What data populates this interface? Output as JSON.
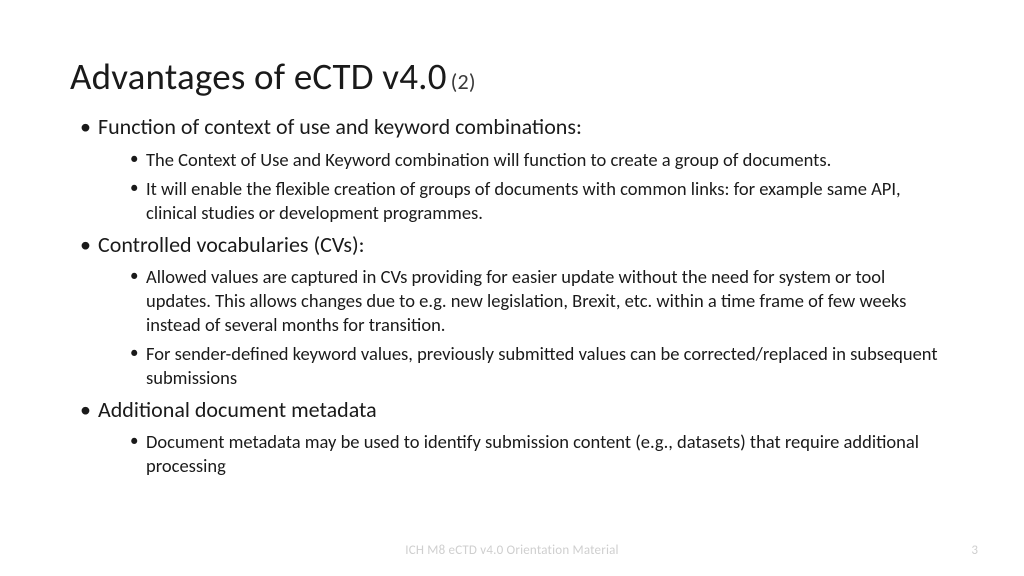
{
  "title": {
    "main": "Advantages of eCTD v4.0",
    "suffix": "(2)"
  },
  "bullets": [
    {
      "text": "Function of context of use and keyword combinations:",
      "children": [
        "The Context of Use and Keyword combination will function to create a group of documents.",
        "It will enable the flexible creation of groups of documents with common links: for example same API, clinical studies or development programmes."
      ]
    },
    {
      "text": "Controlled vocabularies (CVs):",
      "children": [
        "Allowed values are captured in CVs providing for easier update without the need for system or tool updates. This allows changes due to e.g. new legislation, Brexit, etc. within a time frame of few weeks instead of several months for transition.",
        "For sender-defined keyword values, previously submitted values can be corrected/replaced in subsequent submissions"
      ]
    },
    {
      "text": "Additional document metadata",
      "children": [
        "Document metadata may be used to identify submission content (e.g., datasets) that require additional processing"
      ]
    }
  ],
  "footer": "ICH M8 eCTD v4.0 Orientation Material",
  "page_number": "3"
}
